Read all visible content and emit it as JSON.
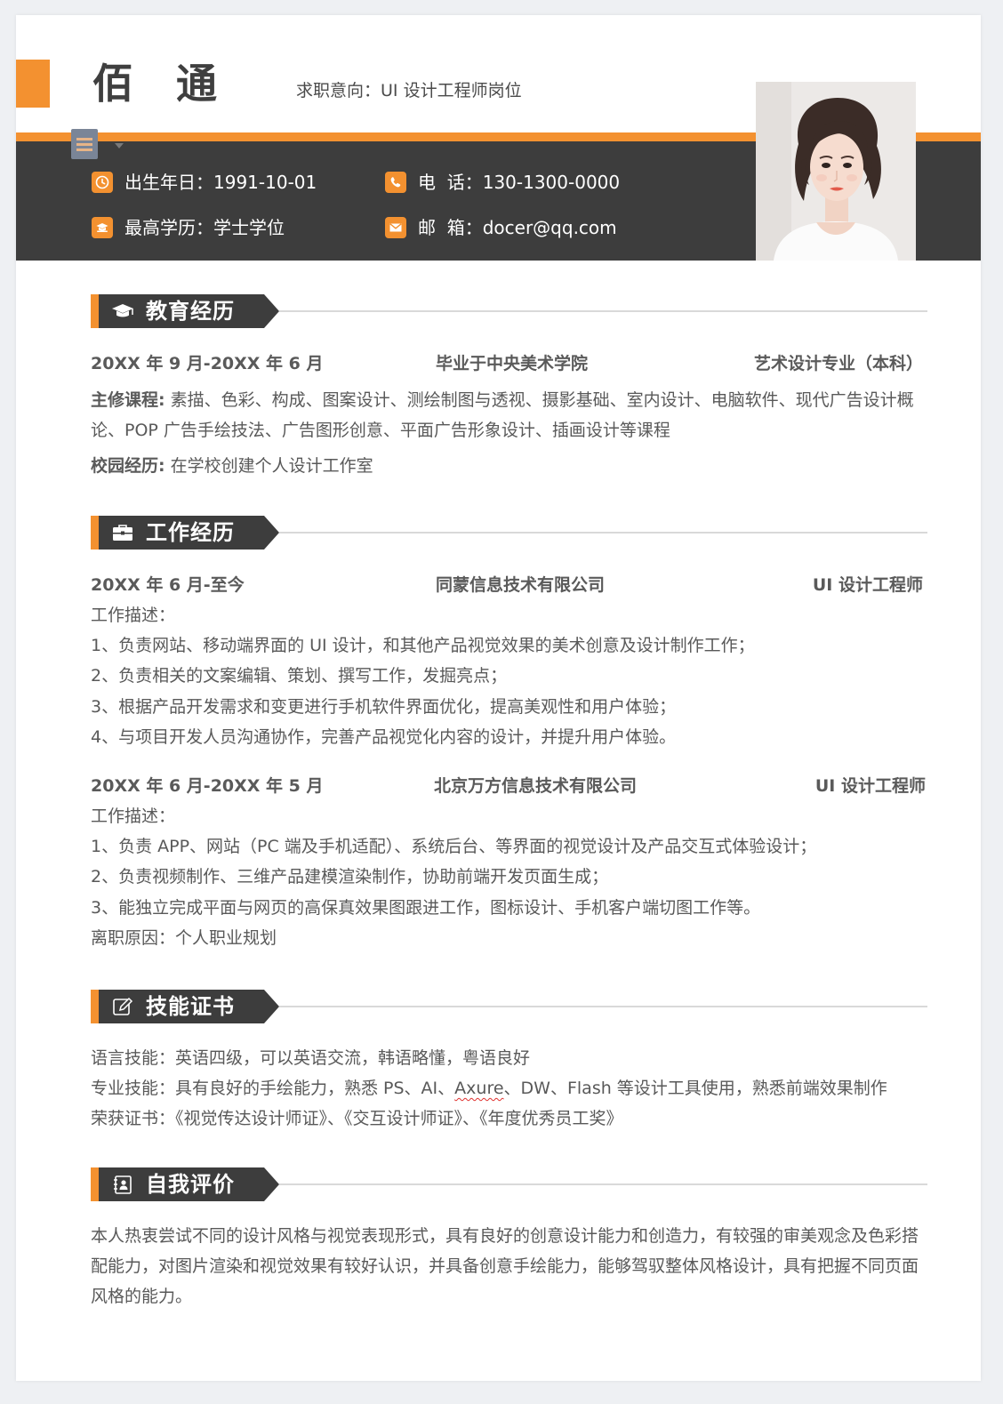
{
  "header": {
    "name": "佰通",
    "intent_label": "求职意向：",
    "intent_value": "UI 设计工程师岗位"
  },
  "info": {
    "birth_label": "出生年日：",
    "birth_value": "1991-10-01",
    "phone_label": "电  话：",
    "phone_value": "130-1300-0000",
    "edu_label": "最高学历：",
    "edu_value": "学士学位",
    "mail_label": "邮  箱：",
    "mail_value": "docer@qq.com"
  },
  "education": {
    "title": "教育经历",
    "period": "20XX 年 9 月-20XX 年 6 月",
    "school": "毕业于中央美术学院",
    "major": "艺术设计专业（本科）",
    "courses_label": "主修课程:",
    "courses_text": " 素描、色彩、构成、图案设计、测绘制图与透视、摄影基础、室内设计、电脑软件、现代广告设计概论、POP 广告手绘技法、广告图形创意、平面广告形象设计、插画设计等课程",
    "campus_label": "校园经历:",
    "campus_text": " 在学校创建个人设计工作室"
  },
  "work": {
    "title": "工作经历",
    "jobs": [
      {
        "period": "20XX 年 6 月-至今",
        "company": "同蒙信息技术有限公司",
        "role": "UI 设计工程师",
        "desc_label": "工作描述：",
        "items": [
          "1、负责网站、移动端界面的 UI 设计，和其他产品视觉效果的美术创意及设计制作工作；",
          "2、负责相关的文案编辑、策划、撰写工作，发掘亮点；",
          "3、根据产品开发需求和变更进行手机软件界面优化，提高美观性和用户体验；",
          "4、与项目开发人员沟通协作，完善产品视觉化内容的设计，并提升用户体验。"
        ]
      },
      {
        "period": "20XX 年 6 月-20XX 年 5 月",
        "company": "北京万方信息技术有限公司",
        "role": "UI 设计工程师",
        "desc_label": "工作描述：",
        "items": [
          "1、负责 APP、网站（PC 端及手机适配）、系统后台、等界面的视觉设计及产品交互式体验设计；",
          "2、负责视频制作、三维产品建模渲染制作，协助前端开发页面生成；",
          "3、能独立完成平面与网页的高保真效果图跟进工作，图标设计、手机客户端切图工作等。"
        ],
        "leave_reason": "离职原因：个人职业规划"
      }
    ]
  },
  "skills": {
    "title": "技能证书",
    "language": "语言技能：英语四级，可以英语交流，韩语略懂，粤语良好",
    "pro_prefix": "专业技能：具有良好的手绘能力，熟悉 PS、AI、",
    "pro_axure": "Axure",
    "pro_suffix": "、DW、Flash 等设计工具使用，熟悉前端效果制作",
    "certs": "荣获证书：《视觉传达设计师证》、《交互设计师证》、《年度优秀员工奖》"
  },
  "self": {
    "title": "自我评价",
    "text": "本人热衷尝试不同的设计风格与视觉表现形式，具有良好的创意设计能力和创造力，有较强的审美观念及色彩搭配能力，对图片渲染和视觉效果有较好认识，并具备创意手绘能力，能够驾驭整体风格设计，具有把握不同页面风格的能力。"
  },
  "colors": {
    "accent": "#f39130",
    "dark": "#3d3d3d",
    "text": "#595959"
  },
  "icons": [
    "clock-icon",
    "phone-icon",
    "graduation-icon",
    "mail-icon",
    "mortarboard-icon",
    "briefcase-icon",
    "edit-icon",
    "contacts-book-icon"
  ]
}
